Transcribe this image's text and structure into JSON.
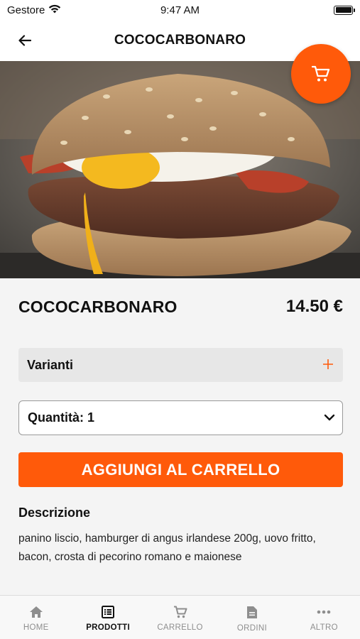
{
  "status_bar": {
    "carrier": "Gestore",
    "time": "9:47 AM"
  },
  "header": {
    "title": "COCOCARBONARO",
    "back_icon": "arrow-left-icon"
  },
  "cart_button": {
    "icon": "cart-icon"
  },
  "product": {
    "name": "COCOCARBONARO",
    "price": "14.50 €"
  },
  "variants": {
    "label": "Varianti",
    "icon": "plus-icon"
  },
  "quantity": {
    "label": "Quantità: 1",
    "icon": "chevron-down-icon"
  },
  "add_to_cart": {
    "label": "AGGIUNGI AL CARRELLO"
  },
  "description": {
    "title": "Descrizione",
    "text": "panino liscio, hamburger di angus irlandese 200g, uovo fritto, bacon, crosta di pecorino romano e maionese"
  },
  "tabs": [
    {
      "label": "HOME",
      "icon": "home-icon",
      "active": false
    },
    {
      "label": "PRODOTTI",
      "icon": "list-icon",
      "active": true
    },
    {
      "label": "CARRELLO",
      "icon": "cart-icon",
      "active": false
    },
    {
      "label": "ORDINI",
      "icon": "document-icon",
      "active": false
    },
    {
      "label": "ALTRO",
      "icon": "more-icon",
      "active": false
    }
  ],
  "colors": {
    "accent": "#ff5a0a",
    "background": "#f4f4f4",
    "variants_bg": "#e7e7e7"
  }
}
